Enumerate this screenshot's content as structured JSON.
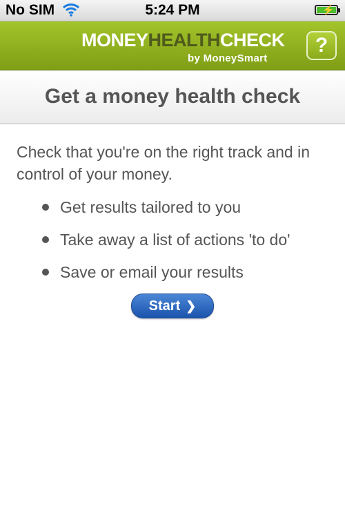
{
  "status_bar": {
    "carrier": "No SIM",
    "time": "5:24 PM",
    "icons": [
      "wifi-icon",
      "battery-charging-icon"
    ]
  },
  "header": {
    "brand_part1": "MONEY",
    "brand_part2": "HEALTH",
    "brand_part3": "CHECK",
    "byline": "by MoneySmart",
    "help_label": "?",
    "colors": {
      "header_green": "#94b620",
      "brand_dark": "#4f5a1c"
    }
  },
  "page": {
    "title": "Get a money health check",
    "intro": "Check that you're on the right track and in control of your money.",
    "bullets": [
      "Get results tailored to you",
      "Take away a list of actions 'to do'",
      "Save or email your results"
    ],
    "start_label": "Start",
    "start_icon": "chevron-right-icon",
    "colors": {
      "start_blue": "#2763b8",
      "text_gray": "#555555"
    }
  }
}
